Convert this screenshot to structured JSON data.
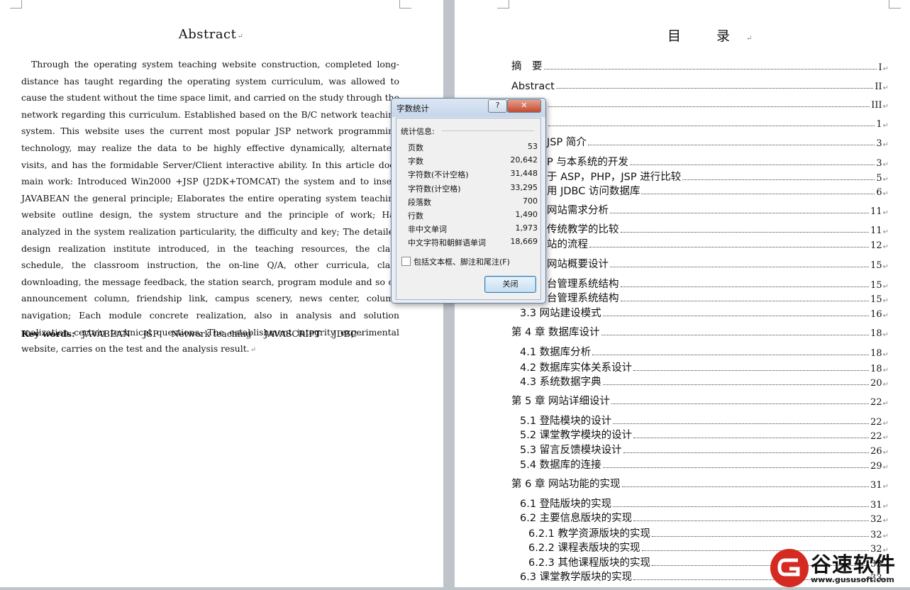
{
  "abstract": {
    "title": "Abstract",
    "para_mark": "↵",
    "body": "Through the operating system teaching website construction, completed long-distance has taught regarding the operating system curriculum, was allowed to cause the student without the time space limit, and carried on the study through the network regarding this curriculum. Established based on the B/C network teaching system. This website uses the current most popular JSP network programming technology, may realize the data to be highly effective dynamically, alternately visits, and has the formidable Server/Client interactive ability. In this article does main work: Introduced Win2000 +JSP (J2DK+TOMCAT) the system and to insert JAVABEAN the general principle; Elaborates the entire operating system teaching website outline design, the system structure and the principle of work; Has analyzed in the system realization particularity, the difficulty and key; The detailed design realization institute introduced, in the teaching resources, the class schedule, the classroom instruction, the on-line Q/A, other curricula, class downloading, the message feedback, the station search, program module and so on announcement column, friendship link, campus scenery, news center, column navigation; Each module concrete realization, also in analysis and solution realization certain technical questions; The establishment integrity experimental website, carries on the test and the analysis result.",
    "keywords_label": "Key words:",
    "keywords": [
      "JAVABEAN",
      "JSP",
      "Network teaching",
      "JAVASCRIPT",
      "JDBC"
    ]
  },
  "toc": {
    "title": "目 录",
    "items": [
      {
        "text": "摘　要",
        "page": "I"
      },
      {
        "text": "Abstract",
        "page": "II"
      },
      {
        "text": "",
        "page": "III"
      },
      {
        "text": "",
        "page": "1"
      },
      {
        "text": "JSP 简介",
        "page": "3"
      },
      {
        "text": "P 与本系统的开发",
        "page": "3"
      },
      {
        "text": "于 ASP，PHP，JSP 进行比较",
        "page": "5"
      },
      {
        "text": "用 JDBC 访问数据库",
        "page": "6"
      },
      {
        "text": "网站需求分析",
        "page": "11"
      },
      {
        "text": "传统教学的比较",
        "page": "11"
      },
      {
        "text": "站的流程",
        "page": "12"
      },
      {
        "text": "网站概要设计",
        "page": "15"
      },
      {
        "text": "台管理系统结构",
        "page": "15"
      },
      {
        "text": "台管理系统结构",
        "page": "15"
      },
      {
        "text": "3.3 网站建设模式",
        "page": "16"
      },
      {
        "text": "第 4 章 数据库设计",
        "page": "18"
      },
      {
        "text": "4.1 数据库分析",
        "page": "18"
      },
      {
        "text": "4.2 数据库实体关系设计",
        "page": "18"
      },
      {
        "text": "4.3 系统数据字典",
        "page": "20"
      },
      {
        "text": "第 5 章 网站详细设计",
        "page": "22"
      },
      {
        "text": "5.1 登陆模块的设计",
        "page": "22"
      },
      {
        "text": "5.2 课堂教学模块的设计",
        "page": "22"
      },
      {
        "text": "5.3 留言反馈模块设计",
        "page": "26"
      },
      {
        "text": "5.4 数据库的连接",
        "page": "29"
      },
      {
        "text": "第 6 章 网站功能的实现",
        "page": "31"
      },
      {
        "text": "6.1 登陆版块的实现",
        "page": "31"
      },
      {
        "text": "6.2 主要信息版块的实现",
        "page": "32"
      },
      {
        "text": "6.2.1 教学资源版块的实现",
        "page": "32"
      },
      {
        "text": "6.2.2 课程表版块的实现",
        "page": "32"
      },
      {
        "text": "6.2.3 其他课程版块的实现",
        "page": "33"
      },
      {
        "text": "6.3 课堂教学版块的实现",
        "page": "33"
      }
    ]
  },
  "dialog": {
    "title": "字数统计",
    "help_label": "?",
    "close_label": "✕",
    "group_label": "统计信息:",
    "stats": [
      {
        "label": "页数",
        "value": "53"
      },
      {
        "label": "字数",
        "value": "20,642"
      },
      {
        "label": "字符数(不计空格)",
        "value": "31,448"
      },
      {
        "label": "字符数(计空格)",
        "value": "33,295"
      },
      {
        "label": "段落数",
        "value": "700"
      },
      {
        "label": "行数",
        "value": "1,490"
      },
      {
        "label": "非中文单词",
        "value": "1,973"
      },
      {
        "label": "中文字符和朝鲜语单词",
        "value": "18,669"
      }
    ],
    "checkbox_label": "包括文本框、脚注和尾注(F)",
    "checkbox_checked": false,
    "ok_label": "关闭"
  },
  "watermark": {
    "brand": "谷速软件",
    "url": "www.gususoft.com"
  },
  "colors": {
    "logo_red": "#d42a22",
    "dialog_frame": "#e8eef6",
    "close_button": "#c44a30"
  }
}
